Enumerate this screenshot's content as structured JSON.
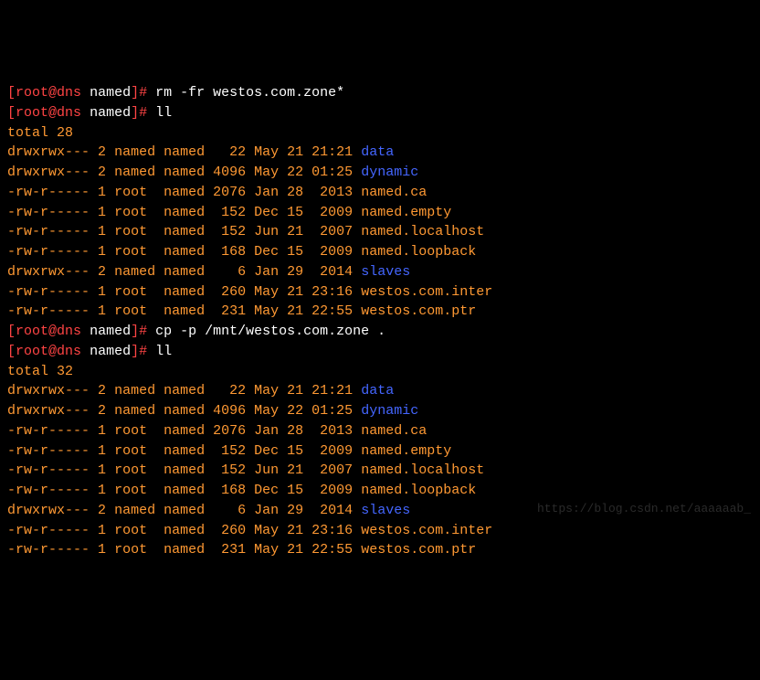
{
  "prompts": [
    {
      "user": "root",
      "host": "dns",
      "dir": "named",
      "cmd": "rm -fr westos.com.zone*"
    },
    {
      "user": "root",
      "host": "dns",
      "dir": "named",
      "cmd": "ll"
    }
  ],
  "total1": "total 28",
  "listing1": [
    {
      "perms": "drwxrwx---",
      "links": "2",
      "owner": "named",
      "group": "named",
      "size": "  22",
      "date": "May 21 21:21",
      "name": "data",
      "dir": true
    },
    {
      "perms": "drwxrwx---",
      "links": "2",
      "owner": "named",
      "group": "named",
      "size": "4096",
      "date": "May 22 01:25",
      "name": "dynamic",
      "dir": true
    },
    {
      "perms": "-rw-r-----",
      "links": "1",
      "owner": "root ",
      "group": "named",
      "size": "2076",
      "date": "Jan 28  2013",
      "name": "named.ca",
      "dir": false
    },
    {
      "perms": "-rw-r-----",
      "links": "1",
      "owner": "root ",
      "group": "named",
      "size": " 152",
      "date": "Dec 15  2009",
      "name": "named.empty",
      "dir": false
    },
    {
      "perms": "-rw-r-----",
      "links": "1",
      "owner": "root ",
      "group": "named",
      "size": " 152",
      "date": "Jun 21  2007",
      "name": "named.localhost",
      "dir": false
    },
    {
      "perms": "-rw-r-----",
      "links": "1",
      "owner": "root ",
      "group": "named",
      "size": " 168",
      "date": "Dec 15  2009",
      "name": "named.loopback",
      "dir": false
    },
    {
      "perms": "drwxrwx---",
      "links": "2",
      "owner": "named",
      "group": "named",
      "size": "   6",
      "date": "Jan 29  2014",
      "name": "slaves",
      "dir": true
    },
    {
      "perms": "-rw-r-----",
      "links": "1",
      "owner": "root ",
      "group": "named",
      "size": " 260",
      "date": "May 21 23:16",
      "name": "westos.com.inter",
      "dir": false
    },
    {
      "perms": "-rw-r-----",
      "links": "1",
      "owner": "root ",
      "group": "named",
      "size": " 231",
      "date": "May 21 22:55",
      "name": "westos.com.ptr",
      "dir": false
    }
  ],
  "prompts2": [
    {
      "user": "root",
      "host": "dns",
      "dir": "named",
      "cmd": "cp -p /mnt/westos.com.zone ."
    },
    {
      "user": "root",
      "host": "dns",
      "dir": "named",
      "cmd": "ll"
    }
  ],
  "total2": "total 32",
  "listing2": [
    {
      "perms": "drwxrwx---",
      "links": "2",
      "owner": "named",
      "group": "named",
      "size": "  22",
      "date": "May 21 21:21",
      "name": "data",
      "dir": true
    },
    {
      "perms": "drwxrwx---",
      "links": "2",
      "owner": "named",
      "group": "named",
      "size": "4096",
      "date": "May 22 01:25",
      "name": "dynamic",
      "dir": true
    },
    {
      "perms": "-rw-r-----",
      "links": "1",
      "owner": "root ",
      "group": "named",
      "size": "2076",
      "date": "Jan 28  2013",
      "name": "named.ca",
      "dir": false
    },
    {
      "perms": "-rw-r-----",
      "links": "1",
      "owner": "root ",
      "group": "named",
      "size": " 152",
      "date": "Dec 15  2009",
      "name": "named.empty",
      "dir": false
    },
    {
      "perms": "-rw-r-----",
      "links": "1",
      "owner": "root ",
      "group": "named",
      "size": " 152",
      "date": "Jun 21  2007",
      "name": "named.localhost",
      "dir": false
    },
    {
      "perms": "-rw-r-----",
      "links": "1",
      "owner": "root ",
      "group": "named",
      "size": " 168",
      "date": "Dec 15  2009",
      "name": "named.loopback",
      "dir": false
    },
    {
      "perms": "drwxrwx---",
      "links": "2",
      "owner": "named",
      "group": "named",
      "size": "   6",
      "date": "Jan 29  2014",
      "name": "slaves",
      "dir": true
    },
    {
      "perms": "-rw-r-----",
      "links": "1",
      "owner": "root ",
      "group": "named",
      "size": " 260",
      "date": "May 21 23:16",
      "name": "westos.com.inter",
      "dir": false
    },
    {
      "perms": "-rw-r-----",
      "links": "1",
      "owner": "root ",
      "group": "named",
      "size": " 231",
      "date": "May 21 22:55",
      "name": "westos.com.ptr",
      "dir": false
    }
  ],
  "watermark": "https://blog.csdn.net/aaaaaab_"
}
